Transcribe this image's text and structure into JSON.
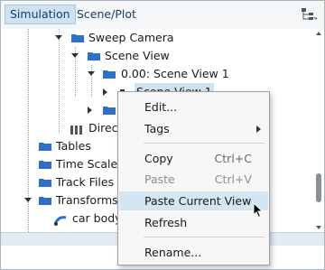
{
  "tabs": [
    {
      "label": "Simulation",
      "active": true
    },
    {
      "label": "Scene/Plot",
      "active": false
    }
  ],
  "toolbar": {
    "tree_view_icon": "tree-hierarchy-icon"
  },
  "tree": {
    "rows": [
      {
        "label": "Sweep Camera",
        "icon": "folder-icon"
      },
      {
        "label": "Scene View",
        "icon": "folder-icon"
      },
      {
        "label": "0.00: Scene View 1",
        "icon": "folder-icon"
      },
      {
        "label": "Scene View 1",
        "icon": "camera-icon",
        "selected": true
      },
      {
        "label": "",
        "icon": "folder-icon"
      },
      {
        "label": "Direc",
        "icon": "directory-icon"
      },
      {
        "label": "Tables",
        "icon": "folder-icon"
      },
      {
        "label": "Time Scales",
        "icon": "folder-icon"
      },
      {
        "label": "Track Files",
        "icon": "folder-icon"
      },
      {
        "label": "Transforms",
        "icon": "folder-icon"
      },
      {
        "label": "car body",
        "icon": "transform-icon"
      }
    ]
  },
  "context_menu": {
    "items": [
      {
        "label": "Edit...",
        "shortcut": "",
        "disabled": false
      },
      {
        "label": "Tags",
        "shortcut": "",
        "disabled": false,
        "submenu": true
      },
      {
        "label": "Copy",
        "shortcut": "Ctrl+C",
        "disabled": false
      },
      {
        "label": "Paste",
        "shortcut": "Ctrl+V",
        "disabled": true
      },
      {
        "label": "Paste Current View",
        "shortcut": "",
        "disabled": false,
        "hover": true
      },
      {
        "label": "Refresh",
        "shortcut": "",
        "disabled": false
      },
      {
        "label": "Rename...",
        "shortcut": "",
        "disabled": false
      }
    ]
  },
  "colors": {
    "accent": "#cfe2f1",
    "folder": "#2f6fc9",
    "menu_hover": "#d5e6f3"
  }
}
